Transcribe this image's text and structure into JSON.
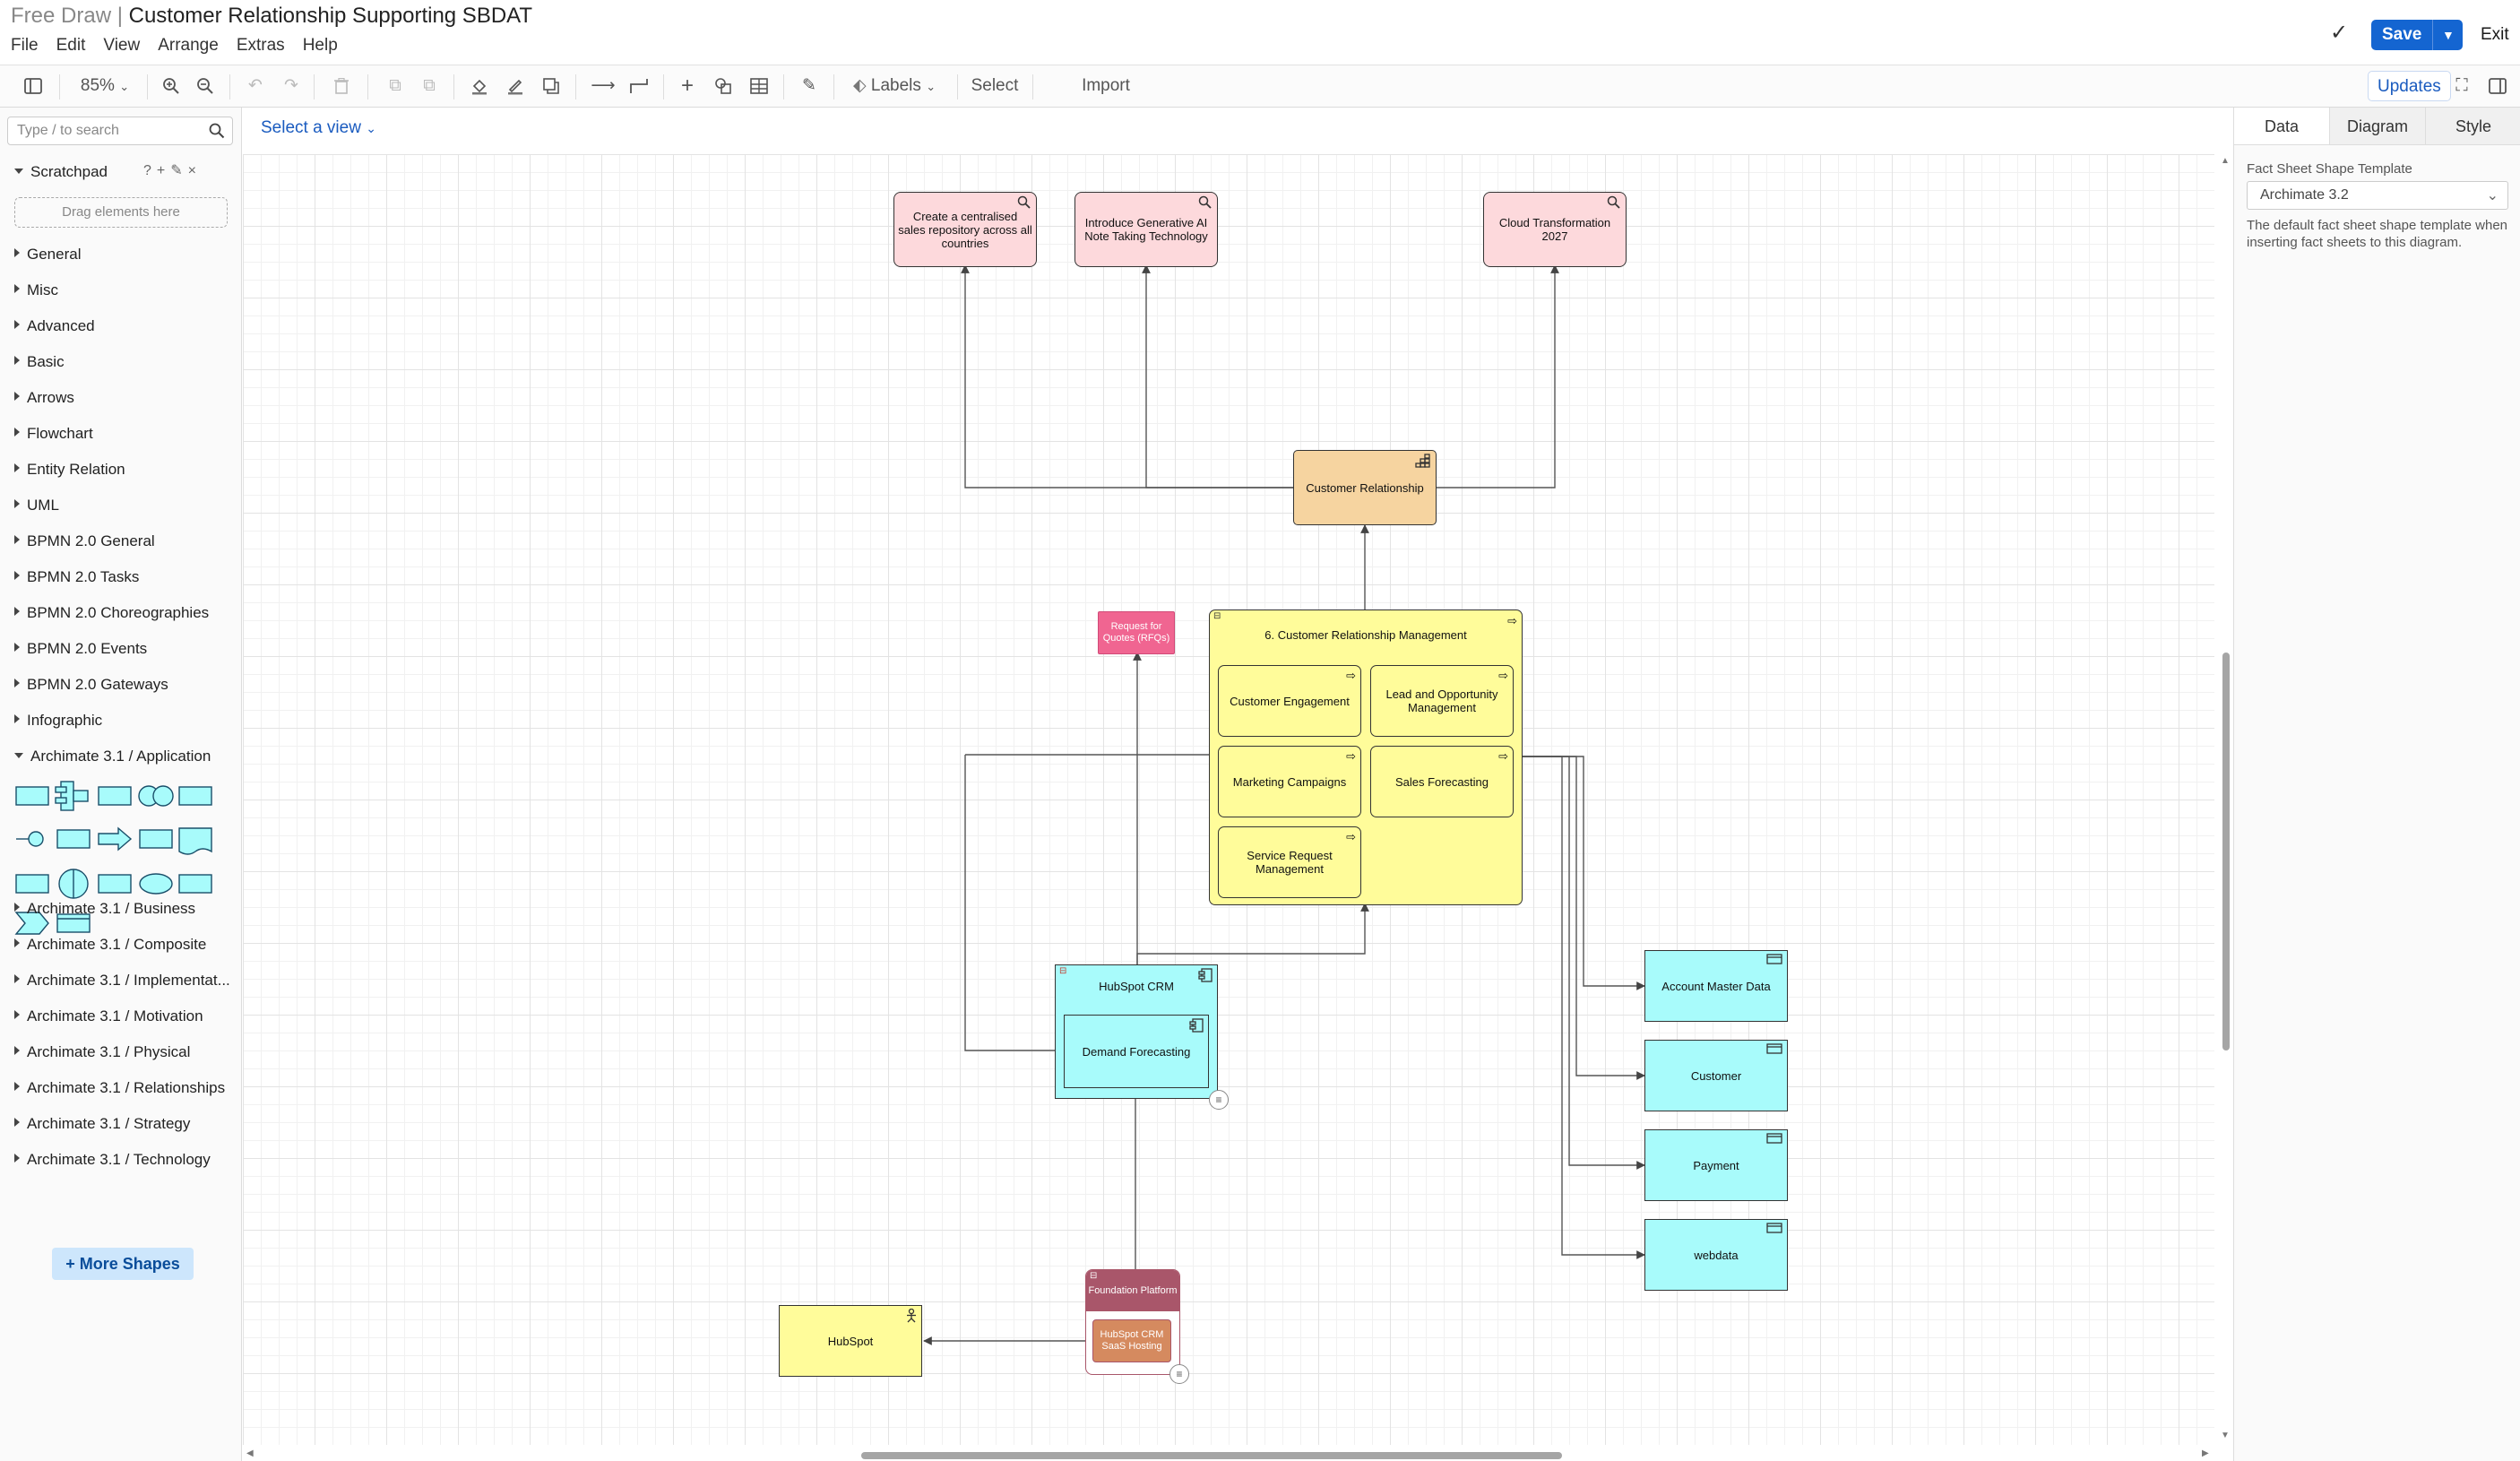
{
  "app": {
    "title_prefix": "Free Draw",
    "title_sep": " | ",
    "title": "Customer Relationship Supporting SBDAT",
    "menu": [
      "File",
      "Edit",
      "View",
      "Arrange",
      "Extras",
      "Help"
    ],
    "save_label": "Save",
    "exit_label": "Exit"
  },
  "toolbar": {
    "zoom": "85%",
    "labels_label": "Labels",
    "select_label": "Select",
    "import_label": "Import Diagrams",
    "updates_label": "Updates"
  },
  "sidebar": {
    "search_placeholder": "Type / to search",
    "scratchpad_label": "Scratchpad",
    "drag_hint": "Drag elements here",
    "categories_top": [
      "General",
      "Misc",
      "Advanced",
      "Basic",
      "Arrows",
      "Flowchart",
      "Entity Relation",
      "UML",
      "BPMN 2.0 General",
      "BPMN 2.0 Tasks",
      "BPMN 2.0 Choreographies",
      "BPMN 2.0 Events",
      "BPMN 2.0 Gateways",
      "Infographic"
    ],
    "open_category": "Archimate 3.1 / Application",
    "categories_bottom": [
      "Archimate 3.1 / Business",
      "Archimate 3.1 / Composite",
      "Archimate 3.1 / Implementat...",
      "Archimate 3.1 / Motivation",
      "Archimate 3.1 / Physical",
      "Archimate 3.1 / Relationships",
      "Archimate 3.1 / Strategy",
      "Archimate 3.1 / Technology"
    ],
    "more_shapes": "+ More Shapes"
  },
  "canvas": {
    "view_select": "Select a view",
    "objectives": [
      "Create a centralised sales repository across all countries",
      "Introduce Generative AI Note Taking Technology",
      "Cloud Transformation 2027"
    ],
    "capability": "Customer Relationship",
    "process_group": "6. Customer Relationship Management",
    "processes": [
      "Customer Engagement",
      "Lead and Opportunity Management",
      "Marketing Campaigns",
      "Sales Forecasting",
      "Service Request Management"
    ],
    "rfq": "Request for Quotes (RFQs)",
    "app_component": "HubSpot CRM",
    "app_sub": "Demand Forecasting",
    "data_objects": [
      "Account Master Data",
      "Customer",
      "Payment",
      "webdata"
    ],
    "platform": "Foundation Platform",
    "platform_sub": "HubSpot CRM SaaS Hosting",
    "provider": "HubSpot"
  },
  "rpanel": {
    "tabs": [
      "Data",
      "Diagram",
      "Style"
    ],
    "fs_label": "Fact Sheet Shape Template",
    "fs_value": "Archimate 3.2",
    "fs_help": "The default fact sheet shape template when inserting fact sheets to this diagram."
  },
  "colors": {
    "accent": "#1465d1",
    "objective": "#fdd9dc",
    "capability": "#f6d4a0",
    "process": "#fffc9a",
    "application": "#a8fbfb",
    "rfq": "#f06591",
    "platform": "#a9566a",
    "platform_sub": "#d58a5f"
  }
}
